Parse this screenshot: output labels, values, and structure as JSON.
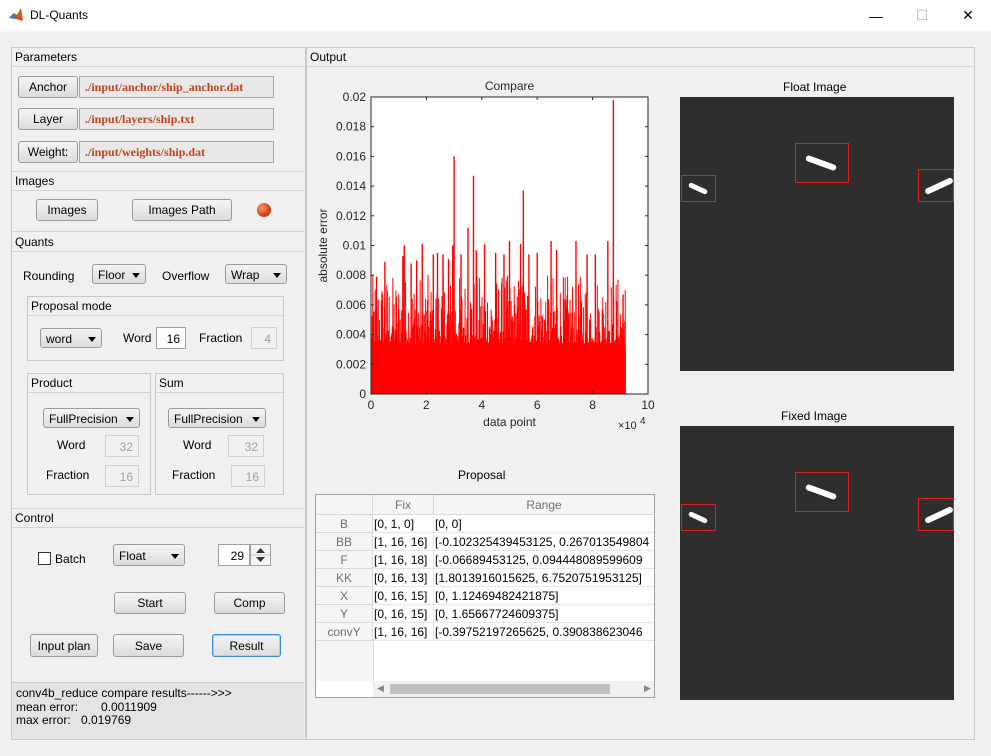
{
  "window": {
    "title": "DL-Quants",
    "minimize": "—",
    "maximize": "☐",
    "close": "✕"
  },
  "parameters": {
    "title": "Parameters",
    "anchor_label": "Anchor",
    "anchor_path": "./input/anchor/ship_anchor.dat",
    "layer_label": "Layer",
    "layer_path": "./input/layers/ship.txt",
    "weight_label": "Weight:",
    "weight_path": "./input/weights/ship.dat"
  },
  "images": {
    "title": "Images",
    "images_label": "Images",
    "path_label": "Images Path",
    "status_color": "#e04a1a"
  },
  "quants": {
    "title": "Quants",
    "rounding_label": "Rounding",
    "rounding_value": "Floor",
    "overflow_label": "Overflow",
    "overflow_value": "Wrap",
    "proposal": {
      "title": "Proposal mode",
      "mode": "word",
      "word_label": "Word",
      "word_value": "16",
      "fraction_label": "Fraction",
      "fraction_value": "4"
    },
    "product": {
      "title": "Product",
      "mode": "FullPrecision",
      "word_label": "Word",
      "word_value": "32",
      "fraction_label": "Fraction",
      "fraction_value": "16"
    },
    "sum": {
      "title": "Sum",
      "mode": "FullPrecision",
      "word_label": "Word",
      "word_value": "32",
      "fraction_label": "Fraction",
      "fraction_value": "16"
    }
  },
  "control": {
    "title": "Control",
    "batch_label": "Batch",
    "batch_checked": false,
    "dtype": "Float",
    "spin_value": "29",
    "start_label": "Start",
    "comp_label": "Comp",
    "input_plan_label": "Input plan",
    "save_label": "Save",
    "result_label": "Result"
  },
  "log": {
    "line1": "conv4b_reduce compare results------>>>",
    "mean_label": "mean error:",
    "mean_value": "0.0011909",
    "max_label": "max error:",
    "max_value": "0.019769"
  },
  "output": {
    "title": "Output",
    "float_title": "Float Image",
    "fixed_title": "Fixed Image",
    "proposal_title": "Proposal"
  },
  "proposal_table": {
    "columns": [
      "Fix",
      "Range"
    ],
    "rows": [
      {
        "name": "B",
        "fix": "[0, 1, 0]",
        "range": "[0, 0]"
      },
      {
        "name": "BB",
        "fix": "[1, 16, 16]",
        "range": "[-0.102325439453125, 0.267013549804"
      },
      {
        "name": "F",
        "fix": "[1, 16, 18]",
        "range": "[-0.06689453125, 0.094448089599609"
      },
      {
        "name": "KK",
        "fix": "[0, 16, 13]",
        "range": "[1.8013916015625, 6.7520751953125]"
      },
      {
        "name": "X",
        "fix": "[0, 16, 15]",
        "range": "[0, 1.12469482421875]"
      },
      {
        "name": "Y",
        "fix": "[0, 16, 15]",
        "range": "[0, 1.65667724609375]"
      },
      {
        "name": "convY",
        "fix": "[1, 16, 16]",
        "range": "[-0.39752197265625, 0.390838623046"
      }
    ]
  },
  "chart_data": {
    "type": "bar",
    "title": "Compare",
    "xlabel": "data point",
    "ylabel": "absolute error",
    "x_multiplier": "×10",
    "x_exponent": "4",
    "xlim": [
      0,
      10
    ],
    "ylim": [
      0,
      0.02
    ],
    "x_ticks": [
      "0",
      "2",
      "4",
      "6",
      "8",
      "10"
    ],
    "y_ticks": [
      "0",
      "0.002",
      "0.004",
      "0.006",
      "0.008",
      "0.01",
      "0.012",
      "0.014",
      "0.016",
      "0.018",
      "0.02"
    ],
    "color": "#ff0000",
    "grid": false,
    "data_extent_x": 9.2,
    "typical_max": 0.0062,
    "peaks": [
      {
        "x": 0.2,
        "y": 0.0079
      },
      {
        "x": 0.5,
        "y": 0.0089
      },
      {
        "x": 1.15,
        "y": 0.0093
      },
      {
        "x": 1.2,
        "y": 0.01
      },
      {
        "x": 1.45,
        "y": 0.0088
      },
      {
        "x": 1.65,
        "y": 0.009
      },
      {
        "x": 1.85,
        "y": 0.0101
      },
      {
        "x": 2.25,
        "y": 0.0094
      },
      {
        "x": 2.4,
        "y": 0.0095
      },
      {
        "x": 2.6,
        "y": 0.0094
      },
      {
        "x": 2.8,
        "y": 0.0091
      },
      {
        "x": 2.95,
        "y": 0.01
      },
      {
        "x": 3.0,
        "y": 0.016
      },
      {
        "x": 3.25,
        "y": 0.0094
      },
      {
        "x": 3.5,
        "y": 0.0112
      },
      {
        "x": 3.7,
        "y": 0.0147
      },
      {
        "x": 3.8,
        "y": 0.0097
      },
      {
        "x": 4.1,
        "y": 0.0101
      },
      {
        "x": 4.5,
        "y": 0.0095
      },
      {
        "x": 4.8,
        "y": 0.0094
      },
      {
        "x": 5.0,
        "y": 0.0103
      },
      {
        "x": 5.4,
        "y": 0.0101
      },
      {
        "x": 5.5,
        "y": 0.0137
      },
      {
        "x": 5.7,
        "y": 0.0094
      },
      {
        "x": 6.0,
        "y": 0.0095
      },
      {
        "x": 6.5,
        "y": 0.0103
      },
      {
        "x": 6.7,
        "y": 0.0097
      },
      {
        "x": 7.4,
        "y": 0.0103
      },
      {
        "x": 7.8,
        "y": 0.0094
      },
      {
        "x": 8.1,
        "y": 0.0094
      },
      {
        "x": 8.55,
        "y": 0.0103
      },
      {
        "x": 8.75,
        "y": 0.0198
      },
      {
        "x": 9.1,
        "y": 0.0067
      }
    ]
  }
}
